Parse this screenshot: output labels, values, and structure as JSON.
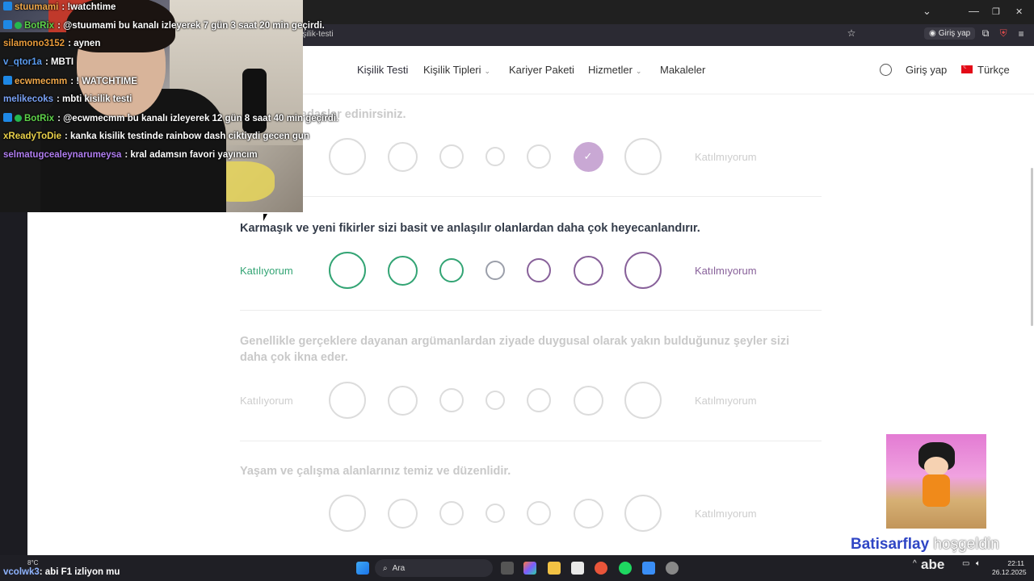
{
  "browser": {
    "url": "işilik-testi",
    "login_button": "Giriş yap",
    "window_controls": {
      "collapse_icon": "chevron-down-icon",
      "minimize": "—",
      "maximize": "❐",
      "close": "✕"
    }
  },
  "site": {
    "nav": [
      {
        "label": "Kişilik Testi"
      },
      {
        "label": "Kişilik Tipleri"
      },
      {
        "label": "Kariyer Paketi"
      },
      {
        "label": "Hizmetler"
      },
      {
        "label": "Makaleler"
      }
    ],
    "login": "Giriş yap",
    "language": "Türkçe"
  },
  "questions": [
    {
      "text": "ak yeni arkadaşlar edinirsiniz.",
      "agree": "",
      "disagree": "Katılmıyorum",
      "state": "answered",
      "selected": 6
    },
    {
      "text": "Karmaşık ve yeni fikirler sizi basit ve anlaşılır olanlardan daha çok heyecanlandırır.",
      "agree": "Katılıyorum",
      "disagree": "Katılmıyorum",
      "state": "active",
      "selected": null
    },
    {
      "text": "Genellikle gerçeklere dayanan argümanlardan ziyade duygusal olarak yakın bulduğunuz şeyler sizi daha çok ikna eder.",
      "agree": "Katılıyorum",
      "disagree": "Katılmıyorum",
      "state": "upcoming",
      "selected": null
    },
    {
      "text": "Yaşam ve çalışma alanlarınız temiz ve düzenlidir.",
      "agree": "",
      "disagree": "Katılmıyorum",
      "state": "upcoming",
      "selected": null
    }
  ],
  "colors": {
    "agree": "#33a474",
    "disagree": "#88619a",
    "neutral": "#9b9faa",
    "faded": "#dcdcdc",
    "selected_fill": "#c9a8d4"
  },
  "chat": [
    {
      "user": "stuumami",
      "user_color": "#f0a84a",
      "msg": ": !watchtime",
      "badge": "blue"
    },
    {
      "user": "BotRix",
      "user_color": "#5fd34a",
      "msg": ": @stuumami bu kanalı izleyerek 7 gün 3 saat 20 min geçirdi.",
      "badge": "blue+green"
    },
    {
      "user": "silamono3152",
      "user_color": "#e89b3a",
      "msg": ": aynen",
      "badge": ""
    },
    {
      "user": "v_qtor1a",
      "user_color": "#5b9cf0",
      "msg": ": MBTI",
      "badge": ""
    },
    {
      "user": "ecwmecmm",
      "user_color": "#f0a84a",
      "msg": ": ! WATCHTIME",
      "badge": "blue"
    },
    {
      "user": "melikecoks",
      "user_color": "#7aa2f5",
      "msg": ": mbti kisilik testi",
      "badge": ""
    },
    {
      "user": "BotRix",
      "user_color": "#5fd34a",
      "msg": ": @ecwmecmm bu kanalı izleyerek 12 gün 8 saat 40 min geçirdi.",
      "badge": "blue+green"
    },
    {
      "user": "xReadyToDie",
      "user_color": "#e9d04a",
      "msg": ": kanka kisilik testinde rainbow dash ciktiydi gecen gun",
      "badge": ""
    },
    {
      "user": "selmatugcealeynarumeysa",
      "user_color": "#b07df0",
      "msg": ": kral adamsın favori yayıncım",
      "badge": ""
    }
  ],
  "last_chat": {
    "user": "vcolwk3",
    "msg": "abi F1 izliyon mu"
  },
  "overlay": {
    "welcome_name": "Batisarflay",
    "welcome_text": "hoşgeldin"
  },
  "taskbar": {
    "search_placeholder": "Ara",
    "weather": "8°C",
    "tray_text": "abe",
    "time": "22:11",
    "date": "26.12.2025"
  }
}
